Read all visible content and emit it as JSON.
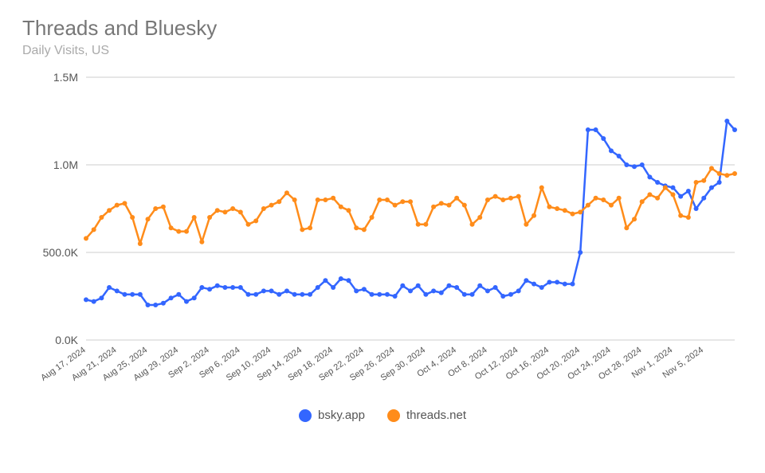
{
  "chart_data": {
    "type": "line",
    "title": "Threads and Bluesky",
    "subtitle": "Daily Visits, US",
    "ylabel": "",
    "xlabel": "",
    "ylim": [
      0,
      1500000
    ],
    "y_ticks": [
      {
        "v": 0,
        "label": "0.0K"
      },
      {
        "v": 500000,
        "label": "500.0K"
      },
      {
        "v": 1000000,
        "label": "1.0M"
      },
      {
        "v": 1500000,
        "label": "1.5M"
      }
    ],
    "x_tick_labels": [
      "Aug 17, 2024",
      "Aug 21, 2024",
      "Aug 25, 2024",
      "Aug 29, 2024",
      "Sep 2, 2024",
      "Sep 6, 2024",
      "Sep 10, 2024",
      "Sep 14, 2024",
      "Sep 18, 2024",
      "Sep 22, 2024",
      "Sep 26, 2024",
      "Sep 30, 2024",
      "Oct 4, 2024",
      "Oct 8, 2024",
      "Oct 12, 2024",
      "Oct 16, 2024",
      "Oct 20, 2024",
      "Oct 24, 2024",
      "Oct 28, 2024",
      "Nov 1, 2024",
      "Nov 5, 2024"
    ],
    "categories": [
      "Aug 17, 2024",
      "Aug 18, 2024",
      "Aug 19, 2024",
      "Aug 20, 2024",
      "Aug 21, 2024",
      "Aug 22, 2024",
      "Aug 23, 2024",
      "Aug 24, 2024",
      "Aug 25, 2024",
      "Aug 26, 2024",
      "Aug 27, 2024",
      "Aug 28, 2024",
      "Aug 29, 2024",
      "Aug 30, 2024",
      "Aug 31, 2024",
      "Sep 1, 2024",
      "Sep 2, 2024",
      "Sep 3, 2024",
      "Sep 4, 2024",
      "Sep 5, 2024",
      "Sep 6, 2024",
      "Sep 7, 2024",
      "Sep 8, 2024",
      "Sep 9, 2024",
      "Sep 10, 2024",
      "Sep 11, 2024",
      "Sep 12, 2024",
      "Sep 13, 2024",
      "Sep 14, 2024",
      "Sep 15, 2024",
      "Sep 16, 2024",
      "Sep 17, 2024",
      "Sep 18, 2024",
      "Sep 19, 2024",
      "Sep 20, 2024",
      "Sep 21, 2024",
      "Sep 22, 2024",
      "Sep 23, 2024",
      "Sep 24, 2024",
      "Sep 25, 2024",
      "Sep 26, 2024",
      "Sep 27, 2024",
      "Sep 28, 2024",
      "Sep 29, 2024",
      "Sep 30, 2024",
      "Oct 1, 2024",
      "Oct 2, 2024",
      "Oct 3, 2024",
      "Oct 4, 2024",
      "Oct 5, 2024",
      "Oct 6, 2024",
      "Oct 7, 2024",
      "Oct 8, 2024",
      "Oct 9, 2024",
      "Oct 10, 2024",
      "Oct 11, 2024",
      "Oct 12, 2024",
      "Oct 13, 2024",
      "Oct 14, 2024",
      "Oct 15, 2024",
      "Oct 16, 2024",
      "Oct 17, 2024",
      "Oct 18, 2024",
      "Oct 19, 2024",
      "Oct 20, 2024",
      "Oct 21, 2024",
      "Oct 22, 2024",
      "Oct 23, 2024",
      "Oct 24, 2024",
      "Oct 25, 2024",
      "Oct 26, 2024",
      "Oct 27, 2024",
      "Oct 28, 2024",
      "Oct 29, 2024",
      "Oct 30, 2024",
      "Oct 31, 2024",
      "Nov 1, 2024",
      "Nov 2, 2024",
      "Nov 3, 2024",
      "Nov 4, 2024",
      "Nov 5, 2024",
      "Nov 6, 2024",
      "Nov 7, 2024",
      "Nov 8, 2024",
      "Nov 9, 2024"
    ],
    "series": [
      {
        "name": "bsky.app",
        "color": "#3366ff",
        "values": [
          230000,
          220000,
          240000,
          300000,
          280000,
          260000,
          260000,
          260000,
          200000,
          200000,
          210000,
          240000,
          260000,
          220000,
          240000,
          300000,
          290000,
          310000,
          300000,
          300000,
          300000,
          260000,
          260000,
          280000,
          280000,
          260000,
          280000,
          260000,
          260000,
          260000,
          300000,
          340000,
          300000,
          350000,
          340000,
          280000,
          290000,
          260000,
          260000,
          260000,
          250000,
          310000,
          280000,
          310000,
          260000,
          280000,
          270000,
          310000,
          300000,
          260000,
          260000,
          310000,
          280000,
          300000,
          250000,
          260000,
          280000,
          340000,
          320000,
          300000,
          330000,
          330000,
          320000,
          320000,
          500000,
          1200000,
          1200000,
          1150000,
          1080000,
          1050000,
          1000000,
          990000,
          1000000,
          930000,
          900000,
          880000,
          870000,
          820000,
          850000,
          750000,
          810000,
          870000,
          900000,
          1250000,
          1200000
        ]
      },
      {
        "name": "threads.net",
        "color": "#ff8c1a",
        "values": [
          580000,
          630000,
          700000,
          740000,
          770000,
          780000,
          700000,
          550000,
          690000,
          750000,
          760000,
          640000,
          620000,
          620000,
          700000,
          560000,
          700000,
          740000,
          730000,
          750000,
          730000,
          660000,
          680000,
          750000,
          770000,
          790000,
          840000,
          800000,
          630000,
          640000,
          800000,
          800000,
          810000,
          760000,
          740000,
          640000,
          630000,
          700000,
          800000,
          800000,
          770000,
          790000,
          790000,
          660000,
          660000,
          760000,
          780000,
          770000,
          810000,
          770000,
          660000,
          700000,
          800000,
          820000,
          800000,
          810000,
          820000,
          660000,
          710000,
          870000,
          760000,
          750000,
          740000,
          720000,
          730000,
          770000,
          810000,
          800000,
          770000,
          810000,
          640000,
          690000,
          790000,
          830000,
          810000,
          870000,
          830000,
          710000,
          700000,
          900000,
          910000,
          980000,
          950000,
          940000,
          950000
        ]
      }
    ],
    "legend_position": "bottom"
  },
  "legend": {
    "items": [
      {
        "label": "bsky.app",
        "color": "#3366ff"
      },
      {
        "label": "threads.net",
        "color": "#ff8c1a"
      }
    ]
  }
}
